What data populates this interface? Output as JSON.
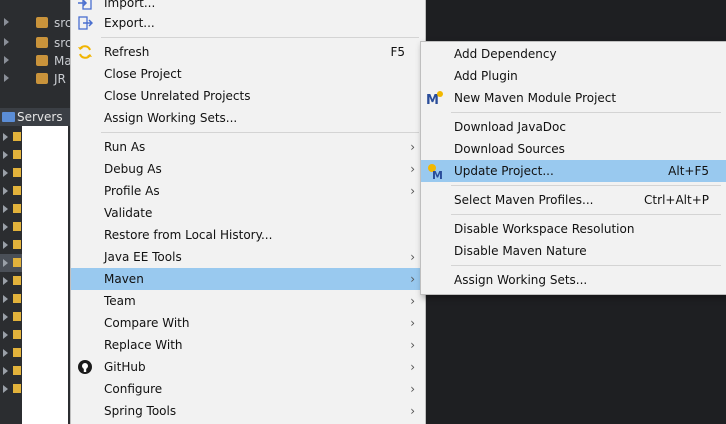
{
  "explorer": {
    "rows": [
      {
        "text": "src"
      },
      {
        "text": "src"
      },
      {
        "text": "Ma"
      },
      {
        "text": "JR"
      }
    ]
  },
  "servers": {
    "tab_label": "Servers"
  },
  "context_menu": {
    "import_label": "Import...",
    "export_label": "Export...",
    "refresh_label": "Refresh",
    "refresh_shortcut": "F5",
    "close_project_label": "Close Project",
    "close_unrelated_label": "Close Unrelated Projects",
    "assign_working_sets_label": "Assign Working Sets...",
    "run_as_label": "Run As",
    "debug_as_label": "Debug As",
    "profile_as_label": "Profile As",
    "validate_label": "Validate",
    "restore_history_label": "Restore from Local History...",
    "java_ee_tools_label": "Java EE Tools",
    "maven_label": "Maven",
    "team_label": "Team",
    "compare_with_label": "Compare With",
    "replace_with_label": "Replace With",
    "github_label": "GitHub",
    "configure_label": "Configure",
    "spring_tools_label": "Spring Tools",
    "submenu_arrow": "›"
  },
  "maven_submenu": {
    "add_dependency_label": "Add Dependency",
    "add_plugin_label": "Add Plugin",
    "new_module_label": "New Maven Module Project",
    "download_javadoc_label": "Download JavaDoc",
    "download_sources_label": "Download Sources",
    "update_project_label": "Update Project...",
    "update_project_shortcut": "Alt+F5",
    "select_profiles_label": "Select Maven Profiles...",
    "select_profiles_shortcut": "Ctrl+Alt+P",
    "disable_workspace_label": "Disable Workspace Resolution",
    "disable_nature_label": "Disable Maven Nature",
    "assign_working_sets_label": "Assign Working Sets..."
  },
  "colors": {
    "highlight": "#99c9ef",
    "menu_bg": "#f2f2f2",
    "ide_bg": "#2b2d30"
  }
}
